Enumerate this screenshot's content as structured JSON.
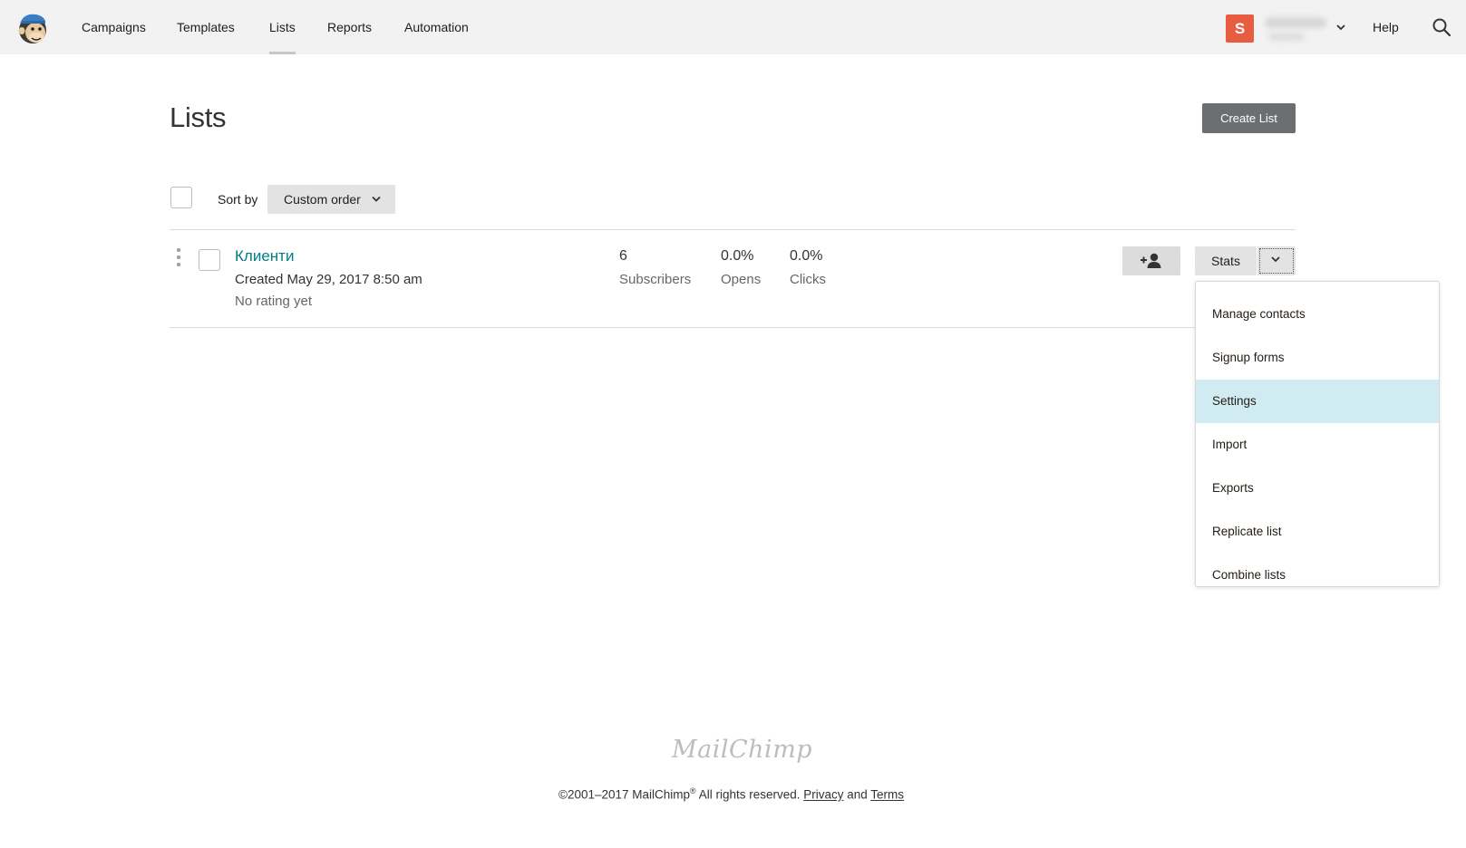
{
  "topnav": {
    "items": [
      {
        "label": "Campaigns",
        "active": false
      },
      {
        "label": "Templates",
        "active": false
      },
      {
        "label": "Lists",
        "active": true
      },
      {
        "label": "Reports",
        "active": false
      },
      {
        "label": "Automation",
        "active": false
      }
    ],
    "avatar_letter": "S",
    "help_label": "Help",
    "icons": {
      "logo": "mailchimp-freddie-logo-icon",
      "search": "search-icon",
      "account_dropdown": "chevron-down-icon"
    },
    "colors": {
      "avatar": "#e85c41",
      "bar": "#f2f2f2"
    }
  },
  "header": {
    "title": "Lists",
    "create_button": "Create List"
  },
  "sort": {
    "label": "Sort by",
    "selected": "Custom order"
  },
  "list": {
    "name": "Клиенти",
    "created": "Created May 29, 2017 8:50 am",
    "rating": "No rating yet",
    "stats": [
      {
        "value": "6",
        "label": "Subscribers"
      },
      {
        "value": "0.0%",
        "label": "Opens"
      },
      {
        "value": "0.0%",
        "label": "Clicks"
      }
    ],
    "stats_button": "Stats",
    "icons": {
      "add_contact": "add-user-icon",
      "more": "kebab-menu-icon"
    }
  },
  "menu": {
    "items": [
      {
        "label": "Manage contacts",
        "highlight": false
      },
      {
        "label": "Signup forms",
        "highlight": false
      },
      {
        "label": "Settings",
        "highlight": true
      },
      {
        "label": "Import",
        "highlight": false
      },
      {
        "label": "Exports",
        "highlight": false
      },
      {
        "label": "Replicate list",
        "highlight": false
      },
      {
        "label": "Combine lists",
        "highlight": false
      }
    ],
    "highlight_color": "#d0ebf2"
  },
  "footer": {
    "logo_text": "MailChimp",
    "copyright_prefix": "©2001–2017 MailChimp",
    "registered": "®",
    "rights": " All rights reserved. ",
    "privacy": "Privacy",
    "and": " and ",
    "terms": "Terms"
  }
}
